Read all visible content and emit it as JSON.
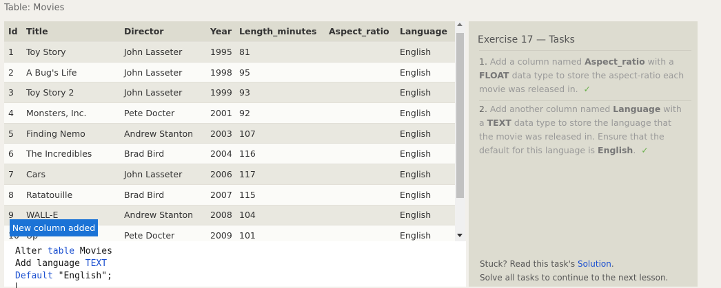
{
  "table_label": "Table: Movies",
  "columns": [
    "Id",
    "Title",
    "Director",
    "Year",
    "Length_minutes",
    "Aspect_ratio",
    "Language"
  ],
  "rows": [
    [
      "1",
      "Toy Story",
      "John Lasseter",
      "1995",
      "81",
      "",
      "English"
    ],
    [
      "2",
      "A Bug's Life",
      "John Lasseter",
      "1998",
      "95",
      "",
      "English"
    ],
    [
      "3",
      "Toy Story 2",
      "John Lasseter",
      "1999",
      "93",
      "",
      "English"
    ],
    [
      "4",
      "Monsters, Inc.",
      "Pete Docter",
      "2001",
      "92",
      "",
      "English"
    ],
    [
      "5",
      "Finding Nemo",
      "Andrew Stanton",
      "2003",
      "107",
      "",
      "English"
    ],
    [
      "6",
      "The Incredibles",
      "Brad Bird",
      "2004",
      "116",
      "",
      "English"
    ],
    [
      "7",
      "Cars",
      "John Lasseter",
      "2006",
      "117",
      "",
      "English"
    ],
    [
      "8",
      "Ratatouille",
      "Brad Bird",
      "2007",
      "115",
      "",
      "English"
    ],
    [
      "9",
      "WALL-E",
      "Andrew Stanton",
      "2008",
      "104",
      "",
      "English"
    ],
    [
      "10",
      "Up",
      "Pete Docter",
      "2009",
      "101",
      "",
      "English"
    ]
  ],
  "toast": "New column added",
  "editor": {
    "line1": {
      "a": "Alter ",
      "b": "table",
      "c": " Movies"
    },
    "line2": {
      "a": "Add language ",
      "b": "TEXT"
    },
    "line3": {
      "a": "Default",
      "b": " \"English\";"
    }
  },
  "tasks": {
    "title": "Exercise 17 — Tasks",
    "task1": {
      "num": "1.",
      "t1": " Add a column named ",
      "b1": "Aspect_ratio",
      "t2": " with a ",
      "b2": "FLOAT",
      "t3": " data type to store the aspect-ratio each movie was released in.",
      "check": "✓"
    },
    "task2": {
      "num": "2.",
      "t1": " Add another column named ",
      "b1": "Language",
      "t2": " with a ",
      "b2": "TEXT",
      "t3": " data type to store the language that the movie was released in. Ensure that the default for this language is ",
      "b3": "English",
      "t4": ".",
      "check": "✓"
    },
    "stuck_text": "Stuck? Read this task's ",
    "solution_link": "Solution",
    "stuck_end": ".",
    "footer": "Solve all tasks to continue to the next lesson."
  }
}
